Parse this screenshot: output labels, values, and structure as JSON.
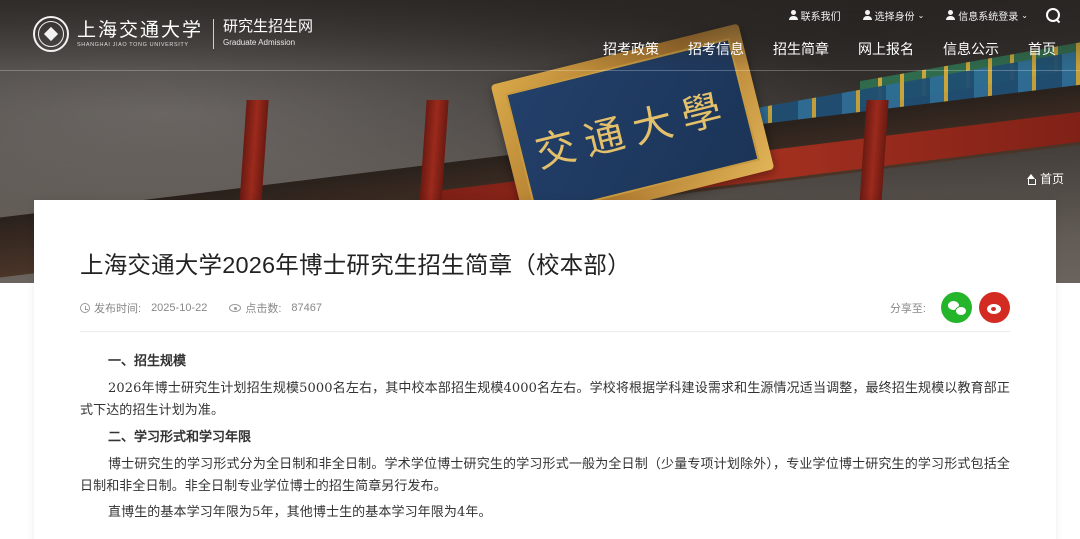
{
  "header": {
    "logo_cn": "上海交通大学",
    "logo_en": "SHANGHAI JIAO TONG UNIVERSITY",
    "site_name": "研究生招生网",
    "site_subtitle": "Graduate Admission",
    "top_links": [
      {
        "label": "联系我们",
        "icon": "person-icon",
        "dropdown": false
      },
      {
        "label": "选择身份",
        "icon": "person-icon",
        "dropdown": true
      },
      {
        "label": "信息系统登录",
        "icon": "person-icon",
        "dropdown": true
      }
    ],
    "search_icon": "search-icon",
    "nav": [
      "招考政策",
      "招考信息",
      "招生简章",
      "网上报名",
      "信息公示",
      "首页"
    ]
  },
  "banner": {
    "plaque_text": "交通大學",
    "breadcrumb_home": "首页"
  },
  "article": {
    "title": "上海交通大学2026年博士研究生招生简章（校本部）",
    "publish_label": "发布时间:",
    "publish_date": "2025-10-22",
    "views_label": "点击数:",
    "views": "87467",
    "share_label": "分享至:",
    "share_targets": [
      "wechat",
      "weibo"
    ],
    "sections": [
      {
        "heading": "一、招生规模",
        "paragraphs": [
          "2026年博士研究生计划招生规模5000名左右，其中校本部招生规模4000名左右。学校将根据学科建设需求和生源情况适当调整，最终招生规模以教育部正式下达的招生计划为准。"
        ]
      },
      {
        "heading": "二、学习形式和学习年限",
        "paragraphs": [
          "博士研究生的学习形式分为全日制和非全日制。学术学位博士研究生的学习形式一般为全日制（少量专项计划除外），专业学位博士研究生的学习形式包括全日制和非全日制。非全日制专业学位博士的招生简章另行发布。",
          "直博生的基本学习年限为5年，其他博士生的基本学习年限为4年。"
        ]
      }
    ]
  },
  "colors": {
    "wechat": "#25b52b",
    "weibo": "#d32b22",
    "title_text": "#222222",
    "meta_text": "#888888"
  }
}
